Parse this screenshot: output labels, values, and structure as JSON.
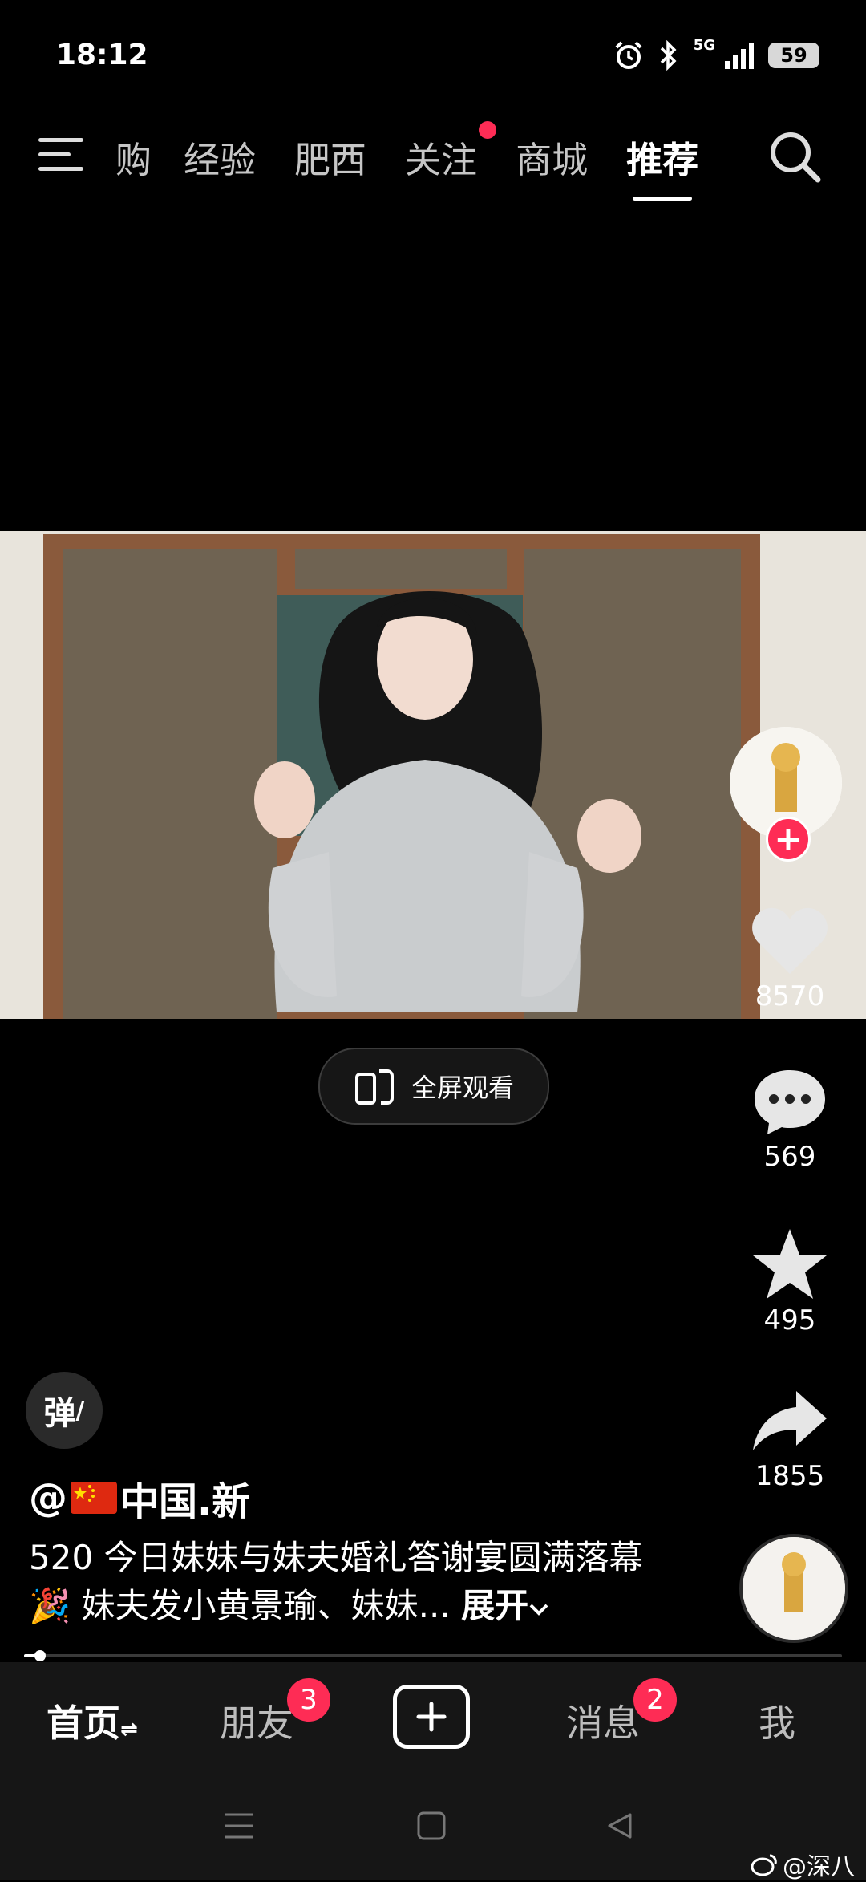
{
  "status_bar": {
    "time": "18:12",
    "network": "5G",
    "battery": "59"
  },
  "top_nav": {
    "tabs": [
      {
        "label": "购",
        "active": false
      },
      {
        "label": "经验",
        "active": false
      },
      {
        "label": "肥西",
        "active": false
      },
      {
        "label": "关注",
        "active": false,
        "dot": true
      },
      {
        "label": "商城",
        "active": false
      },
      {
        "label": "推荐",
        "active": true
      }
    ]
  },
  "video": {
    "fullscreen_label": "全屏观看"
  },
  "actions": {
    "likes": "8570",
    "comments": "569",
    "favorites": "495",
    "shares": "1855"
  },
  "danmaku_label": "弹",
  "post": {
    "author_prefix": "@",
    "author_name": "中国.新",
    "description": "520 今日妹妹与妹夫婚礼答谢宴圆满落幕🎉 妹夫发小黄景瑜、妹妹...",
    "expand_label": "展开",
    "progress": 0.02
  },
  "bottom_nav": {
    "home": "首页",
    "friends": "朋友",
    "friends_badge": "3",
    "messages": "消息",
    "messages_badge": "2",
    "me": "我"
  },
  "watermark": "@深八",
  "colors": {
    "accent": "#fe2c55",
    "bottom_bar": "#161616"
  }
}
